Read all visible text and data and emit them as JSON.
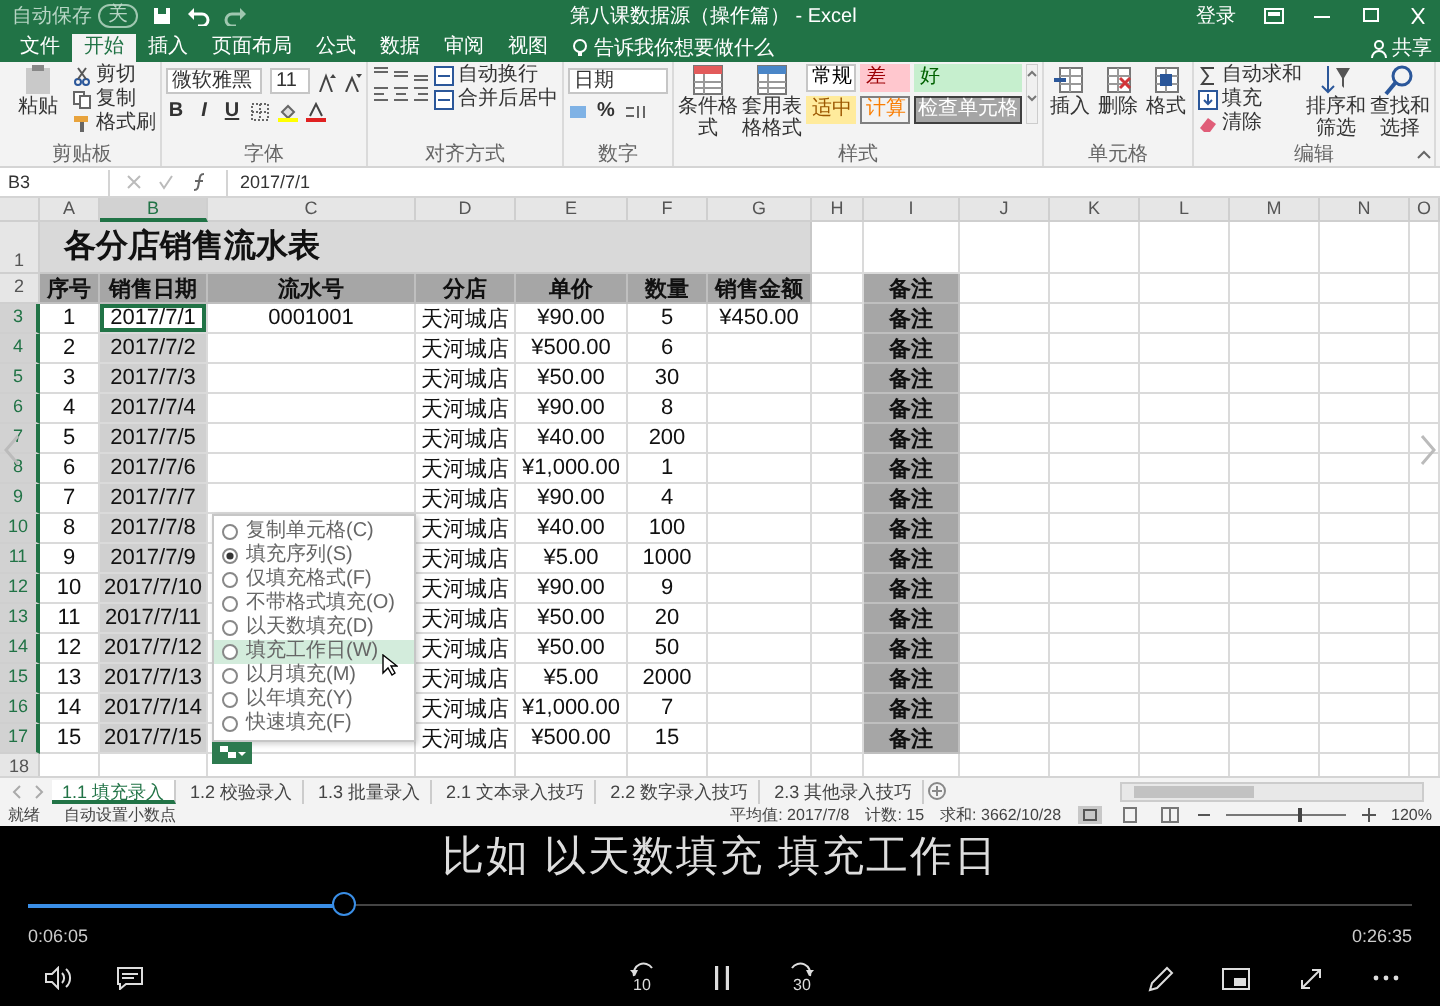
{
  "window": {
    "title": "第八课数据源（操作篇） - Excel",
    "autosave": {
      "label": "自动保存",
      "state": "关",
      "on": false
    },
    "account": "登录"
  },
  "ribbon": {
    "tabs": [
      {
        "label": "文件",
        "selected": false
      },
      {
        "label": "开始",
        "selected": true
      },
      {
        "label": "插入",
        "selected": false
      },
      {
        "label": "页面布局",
        "selected": false
      },
      {
        "label": "公式",
        "selected": false
      },
      {
        "label": "数据",
        "selected": false
      },
      {
        "label": "审阅",
        "selected": false
      },
      {
        "label": "视图",
        "selected": false
      }
    ],
    "tell_me": "告诉我你想要做什么",
    "share": "共享",
    "clipboard": {
      "label": "剪贴板",
      "paste": "粘贴",
      "small": [
        "剪切",
        "复制",
        "格式刷"
      ]
    },
    "font": {
      "label": "字体",
      "font_name": "微软雅黑",
      "font_size": "11",
      "styles": [
        "B",
        "I",
        "U"
      ]
    },
    "alignment": {
      "label": "对齐方式",
      "commands": [
        "自动换行",
        "合并后居中"
      ]
    },
    "number": {
      "label": "数字",
      "format": "日期",
      "percent": "%"
    },
    "styles": {
      "label": "样式",
      "large": [
        "条件格式",
        "套用表格格式"
      ],
      "gallery": [
        {
          "label": "常规",
          "kind": "normal"
        },
        {
          "label": "差",
          "kind": "bad"
        },
        {
          "label": "好",
          "kind": "good"
        },
        {
          "label": "适中",
          "kind": "neutral"
        },
        {
          "label": "计算",
          "kind": "calculation"
        },
        {
          "label": "检查单元格",
          "kind": "check"
        }
      ]
    },
    "cells": {
      "label": "单元格",
      "large": [
        "插入",
        "删除",
        "格式"
      ]
    },
    "editing": {
      "label": "编辑",
      "small": [
        "自动求和",
        "填充",
        "清除"
      ],
      "large": [
        "排序和筛选",
        "查找和选择"
      ]
    }
  },
  "formula_bar": {
    "name_box": "B3",
    "value": "2017/7/1"
  },
  "sheet": {
    "columns": [
      {
        "label": "A",
        "selected": false
      },
      {
        "label": "B",
        "selected": true
      },
      {
        "label": "C",
        "selected": false
      },
      {
        "label": "D",
        "selected": false
      },
      {
        "label": "E",
        "selected": false
      },
      {
        "label": "F",
        "selected": false
      },
      {
        "label": "G",
        "selected": false
      },
      {
        "label": "H",
        "selected": false
      },
      {
        "label": "I",
        "selected": false
      },
      {
        "label": "J",
        "selected": false
      },
      {
        "label": "K",
        "selected": false
      },
      {
        "label": "L",
        "selected": false
      },
      {
        "label": "M",
        "selected": false
      },
      {
        "label": "N",
        "selected": false
      },
      {
        "label": "O",
        "selected": false
      }
    ],
    "rows": [
      {
        "number": "1",
        "kind": "title",
        "selected": false,
        "title": "各分店销售流水表"
      },
      {
        "number": "2",
        "kind": "header",
        "selected": false,
        "cells": [
          "序号",
          "销售日期",
          "流水号",
          "分店",
          "单价",
          "数量",
          "销售金额"
        ],
        "note": "备注"
      },
      {
        "number": "3",
        "kind": "data",
        "selected": true,
        "active": true,
        "cells": [
          "1",
          "2017/7/1",
          "0001001",
          "天河城店",
          "¥90.00",
          "5",
          "¥450.00"
        ],
        "note": "备注"
      },
      {
        "number": "4",
        "kind": "data",
        "selected": true,
        "active": false,
        "cells": [
          "2",
          "2017/7/2",
          "",
          "天河城店",
          "¥500.00",
          "6",
          ""
        ],
        "note": "备注"
      },
      {
        "number": "5",
        "kind": "data",
        "selected": true,
        "active": false,
        "cells": [
          "3",
          "2017/7/3",
          "",
          "天河城店",
          "¥50.00",
          "30",
          ""
        ],
        "note": "备注"
      },
      {
        "number": "6",
        "kind": "data",
        "selected": true,
        "active": false,
        "cells": [
          "4",
          "2017/7/4",
          "",
          "天河城店",
          "¥90.00",
          "8",
          ""
        ],
        "note": "备注"
      },
      {
        "number": "7",
        "kind": "data",
        "selected": true,
        "active": false,
        "cells": [
          "5",
          "2017/7/5",
          "",
          "天河城店",
          "¥40.00",
          "200",
          ""
        ],
        "note": "备注"
      },
      {
        "number": "8",
        "kind": "data",
        "selected": true,
        "active": false,
        "cells": [
          "6",
          "2017/7/6",
          "",
          "天河城店",
          "¥1,000.00",
          "1",
          ""
        ],
        "note": "备注"
      },
      {
        "number": "9",
        "kind": "data",
        "selected": true,
        "active": false,
        "cells": [
          "7",
          "2017/7/7",
          "",
          "天河城店",
          "¥90.00",
          "4",
          ""
        ],
        "note": "备注"
      },
      {
        "number": "10",
        "kind": "data",
        "selected": true,
        "active": false,
        "cells": [
          "8",
          "2017/7/8",
          "",
          "天河城店",
          "¥40.00",
          "100",
          ""
        ],
        "note": "备注"
      },
      {
        "number": "11",
        "kind": "data",
        "selected": true,
        "active": false,
        "cells": [
          "9",
          "2017/7/9",
          "",
          "天河城店",
          "¥5.00",
          "1000",
          ""
        ],
        "note": "备注"
      },
      {
        "number": "12",
        "kind": "data",
        "selected": true,
        "active": false,
        "cells": [
          "10",
          "2017/7/10",
          "",
          "天河城店",
          "¥90.00",
          "9",
          ""
        ],
        "note": "备注"
      },
      {
        "number": "13",
        "kind": "data",
        "selected": true,
        "active": false,
        "cells": [
          "11",
          "2017/7/11",
          "",
          "天河城店",
          "¥50.00",
          "20",
          ""
        ],
        "note": "备注"
      },
      {
        "number": "14",
        "kind": "data",
        "selected": true,
        "active": false,
        "cells": [
          "12",
          "2017/7/12",
          "",
          "天河城店",
          "¥50.00",
          "50",
          ""
        ],
        "note": "备注"
      },
      {
        "number": "15",
        "kind": "data",
        "selected": true,
        "active": false,
        "cells": [
          "13",
          "2017/7/13",
          "",
          "天河城店",
          "¥5.00",
          "2000",
          ""
        ],
        "note": "备注"
      },
      {
        "number": "16",
        "kind": "data",
        "selected": true,
        "active": false,
        "cells": [
          "14",
          "2017/7/14",
          "",
          "天河城店",
          "¥1,000.00",
          "7",
          ""
        ],
        "note": "备注"
      },
      {
        "number": "17",
        "kind": "data",
        "selected": true,
        "active": false,
        "cells": [
          "15",
          "2017/7/15",
          "",
          "天河城店",
          "¥500.00",
          "15",
          ""
        ],
        "note": "备注"
      },
      {
        "number": "18",
        "kind": "empty",
        "selected": false
      }
    ]
  },
  "fill_menu": {
    "options": [
      {
        "label": "复制单元格(C)",
        "selected": false,
        "hovered": false
      },
      {
        "label": "填充序列(S)",
        "selected": true,
        "hovered": false
      },
      {
        "label": "仅填充格式(F)",
        "selected": false,
        "hovered": false
      },
      {
        "label": "不带格式填充(O)",
        "selected": false,
        "hovered": false
      },
      {
        "label": "以天数填充(D)",
        "selected": false,
        "hovered": false
      },
      {
        "label": "填充工作日(W)",
        "selected": false,
        "hovered": true
      },
      {
        "label": "以月填充(M)",
        "selected": false,
        "hovered": false
      },
      {
        "label": "以年填充(Y)",
        "selected": false,
        "hovered": false
      },
      {
        "label": "快速填充(F)",
        "selected": false,
        "hovered": false
      }
    ]
  },
  "sheet_tabs": [
    {
      "label": "1.1 填充录入",
      "selected": true
    },
    {
      "label": "1.2 校验录入",
      "selected": false
    },
    {
      "label": "1.3 批量录入",
      "selected": false
    },
    {
      "label": "2.1 文本录入技巧",
      "selected": false
    },
    {
      "label": "2.2 数字录入技巧",
      "selected": false
    },
    {
      "label": "2.3 其他录入技巧",
      "selected": false
    }
  ],
  "status_bar": {
    "mode": "就绪",
    "note": "自动设置小数点",
    "stats": [
      "平均值: 2017/7/8",
      "计数: 15",
      "求和: 3662/10/28"
    ],
    "zoom": "120%",
    "level": 0.6
  },
  "player": {
    "subtitle": "比如 以天数填充 填充工作日",
    "elapsed": "0:06:05",
    "total": "0:26:35",
    "level": 0.229,
    "playing": true,
    "skip_back": "10",
    "skip_forward": "30"
  }
}
